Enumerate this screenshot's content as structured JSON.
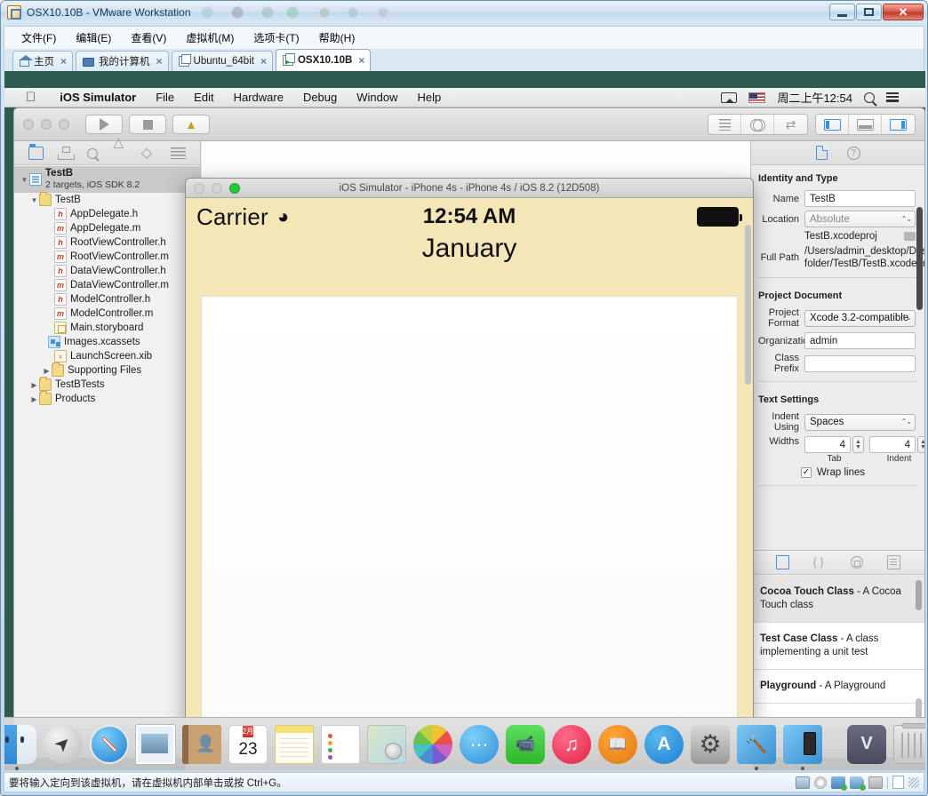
{
  "vmware": {
    "title": "OSX10.10B - VMware Workstation",
    "app_icon": "vmware-icon",
    "window_buttons": {
      "minimize": "minimize-button",
      "maximize": "maximize-button",
      "close": "✕"
    },
    "menu": [
      {
        "label": "文件(F)",
        "mnemonic": "F"
      },
      {
        "label": "编辑(E)",
        "mnemonic": "E"
      },
      {
        "label": "查看(V)",
        "mnemonic": "V"
      },
      {
        "label": "虚拟机(M)",
        "mnemonic": "M"
      },
      {
        "label": "选项卡(T)",
        "mnemonic": "T"
      },
      {
        "label": "帮助(H)",
        "mnemonic": "H"
      }
    ],
    "tabs": [
      {
        "label": "主页",
        "icon": "home-icon",
        "active": false
      },
      {
        "label": "我的计算机",
        "icon": "monitor-icon",
        "active": false
      },
      {
        "label": "Ubuntu_64bit",
        "icon": "vm-icon",
        "active": false
      },
      {
        "label": "OSX10.10B",
        "icon": "vm-running-icon",
        "active": true
      }
    ],
    "statusbar": {
      "message": "要将输入定向到该虚拟机，请在虚拟机内部单击或按 Ctrl+G。",
      "icons": [
        "hard-disk-icon",
        "cd-drive-icon",
        "network-icon",
        "sound-icon",
        "camera-icon",
        "document-icon",
        "resize-grip-icon"
      ]
    }
  },
  "macos": {
    "menubar": {
      "apple": "",
      "items": [
        {
          "label": "iOS Simulator",
          "bold": true
        },
        {
          "label": "File",
          "bold": false
        },
        {
          "label": "Edit",
          "bold": false
        },
        {
          "label": "Hardware",
          "bold": false
        },
        {
          "label": "Debug",
          "bold": false
        },
        {
          "label": "Window",
          "bold": false
        },
        {
          "label": "Help",
          "bold": false
        }
      ],
      "right": {
        "airplay": "airplay-icon",
        "flag": "us-flag-icon",
        "clock": "周二上午12:54",
        "spotlight": "search-icon",
        "notifications": "notification-center-icon"
      }
    },
    "dock": [
      {
        "name": "Finder",
        "class": "di-finder",
        "running": true
      },
      {
        "name": "Launchpad",
        "class": "di-launchpad",
        "running": false
      },
      {
        "name": "Safari",
        "class": "di-safari",
        "running": false
      },
      {
        "name": "Mail",
        "class": "di-mail",
        "running": false
      },
      {
        "name": "Contacts",
        "class": "di-contacts",
        "running": false
      },
      {
        "name": "Calendar",
        "class": "di-calendar",
        "running": false,
        "month": "2月",
        "day": "23"
      },
      {
        "name": "Notes",
        "class": "di-notes",
        "running": false
      },
      {
        "name": "Reminders",
        "class": "di-reminders",
        "running": false
      },
      {
        "name": "Maps",
        "class": "di-maps",
        "running": false
      },
      {
        "name": "Photos",
        "class": "di-photos",
        "running": false
      },
      {
        "name": "Messages",
        "class": "di-messages",
        "running": false
      },
      {
        "name": "FaceTime",
        "class": "di-facetime",
        "running": false
      },
      {
        "name": "iTunes",
        "class": "di-itunes",
        "running": false
      },
      {
        "name": "iBooks",
        "class": "di-ibooks",
        "running": false
      },
      {
        "name": "App Store",
        "class": "di-appstore",
        "running": false
      },
      {
        "name": "System Preferences",
        "class": "di-sysprefs",
        "running": false
      },
      {
        "name": "Xcode",
        "class": "di-xcode",
        "running": true
      },
      {
        "name": "iOS Simulator",
        "class": "di-simulator",
        "running": true
      },
      {
        "name": "separator",
        "class": "dock-sep",
        "running": false
      },
      {
        "name": "VMware Tools",
        "class": "di-vmtools",
        "running": false
      },
      {
        "name": "Trash",
        "class": "di-trash",
        "running": false
      }
    ]
  },
  "xcode": {
    "toolbar": {
      "run_button": "run-button",
      "stop_button": "stop-button",
      "scheme_icon": "xcode-scheme-icon",
      "editor_segments": [
        "standard-editor",
        "assistant-editor",
        "version-editor"
      ],
      "panel_segments": [
        "navigator-toggle",
        "debug-area-toggle",
        "utilities-toggle"
      ]
    },
    "navigator": {
      "tabs": [
        "project-navigator",
        "symbol-navigator",
        "find-navigator",
        "issue-navigator",
        "test-navigator",
        "log-navigator"
      ],
      "project": {
        "name": "TestB",
        "subtitle": "2 targets, iOS SDK 8.2"
      },
      "tree": [
        {
          "label": "TestB",
          "icon": "folder",
          "depth": 1,
          "disclosure": "open"
        },
        {
          "label": "AppDelegate.h",
          "icon": "h",
          "depth": 2,
          "disclosure": "none"
        },
        {
          "label": "AppDelegate.m",
          "icon": "m",
          "depth": 2,
          "disclosure": "none"
        },
        {
          "label": "RootViewController.h",
          "icon": "h",
          "depth": 2,
          "disclosure": "none"
        },
        {
          "label": "RootViewController.m",
          "icon": "m",
          "depth": 2,
          "disclosure": "none"
        },
        {
          "label": "DataViewController.h",
          "icon": "h",
          "depth": 2,
          "disclosure": "none"
        },
        {
          "label": "DataViewController.m",
          "icon": "m",
          "depth": 2,
          "disclosure": "none"
        },
        {
          "label": "ModelController.h",
          "icon": "h",
          "depth": 2,
          "disclosure": "none"
        },
        {
          "label": "ModelController.m",
          "icon": "m",
          "depth": 2,
          "disclosure": "none"
        },
        {
          "label": "Main.storyboard",
          "icon": "sb",
          "depth": 2,
          "disclosure": "none"
        },
        {
          "label": "Images.xcassets",
          "icon": "xc",
          "depth": 2,
          "disclosure": "none"
        },
        {
          "label": "LaunchScreen.xib",
          "icon": "xib",
          "depth": 2,
          "disclosure": "none"
        },
        {
          "label": "Supporting Files",
          "icon": "folder",
          "depth": 2,
          "disclosure": "closed"
        },
        {
          "label": "TestBTests",
          "icon": "folder",
          "depth": 1,
          "disclosure": "closed"
        },
        {
          "label": "Products",
          "icon": "folder",
          "depth": 1,
          "disclosure": "closed"
        }
      ],
      "bottom": {
        "add_label": "+",
        "recent_icon": "clock-icon",
        "filter_icon": "filter-icon",
        "search_placeholder": ""
      }
    },
    "inspector": {
      "tabs": [
        "file-inspector",
        "quick-help-inspector"
      ],
      "sections": [
        {
          "title": "Identity and Type",
          "rows": [
            {
              "label": "Name",
              "type": "field",
              "value": "TestB"
            },
            {
              "label": "Location",
              "type": "select",
              "value": "Absolute",
              "muted": true
            },
            {
              "label": "",
              "type": "static",
              "value": "TestB.xcodeproj"
            },
            {
              "label": "Full Path",
              "type": "path",
              "value": "/Users/admin_desktop/Desktop/untitled folder/TestB/TestB.xcodeproj"
            }
          ]
        },
        {
          "title": "Project Document",
          "rows": [
            {
              "label": "Project Format",
              "type": "select",
              "value": "Xcode 3.2-compatible",
              "muted": false
            },
            {
              "label": "Organization",
              "type": "field",
              "value": "admin"
            },
            {
              "label": "Class Prefix",
              "type": "field",
              "value": ""
            }
          ]
        },
        {
          "title": "Text Settings",
          "rows": [
            {
              "label": "Indent Using",
              "type": "select",
              "value": "Spaces",
              "muted": false
            },
            {
              "label": "Widths",
              "type": "steppers",
              "tab_value": "4",
              "indent_value": "4",
              "tab_sublabel": "Tab",
              "indent_sublabel": "Indent"
            },
            {
              "label": "",
              "type": "checkbox",
              "value": "Wrap lines",
              "checked": true
            }
          ]
        }
      ],
      "library": {
        "tabs": [
          "file-template-library",
          "code-snippet-library",
          "object-library",
          "media-library"
        ],
        "items": [
          {
            "bold": "Cocoa Touch Class",
            "rest": "- A Cocoa Touch class",
            "selected": true
          },
          {
            "bold": "Test Case Class",
            "rest": "- A class implementing a unit test",
            "selected": false
          },
          {
            "bold": "Playground",
            "rest": "- A Playground",
            "selected": false
          }
        ],
        "search_placeholder": ""
      }
    }
  },
  "simulator": {
    "title": "iOS Simulator - iPhone 4s - iPhone 4s / iOS 8.2 (12D508)",
    "traffic_lights": [
      "close-button",
      "minimize-button",
      "zoom-button"
    ],
    "status_bar": {
      "carrier": "Carrier",
      "wifi": "wifi-icon",
      "time": "12:54 AM",
      "battery": "battery-icon"
    },
    "content": {
      "month": "January"
    }
  }
}
